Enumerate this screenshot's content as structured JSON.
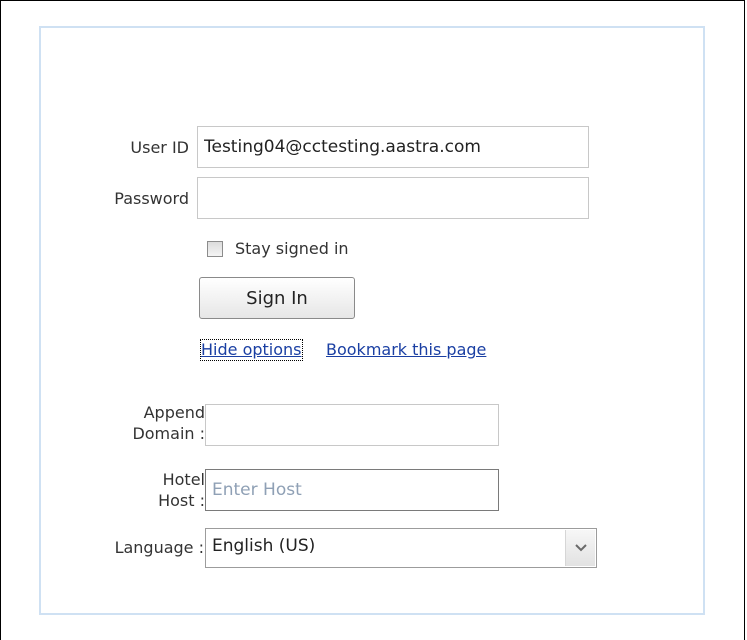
{
  "login": {
    "user_id_label": "User ID",
    "user_id_value": "Testing04@cctesting.aastra.com",
    "password_label": "Password",
    "password_value": "",
    "stay_signed_in_label": "Stay signed in",
    "sign_in_label": "Sign In",
    "hide_options_label": "Hide options",
    "bookmark_label": "Bookmark this page"
  },
  "options": {
    "append_domain_label_1": "Append",
    "append_domain_label_2": "Domain :",
    "append_domain_value": "",
    "hotel_host_label_1": "Hotel",
    "hotel_host_label_2": "Host :",
    "hotel_host_placeholder": "Enter Host",
    "language_label": "Language :",
    "language_selected": "English (US)"
  },
  "icons": {
    "dropdown": "chevron-down-icon"
  }
}
